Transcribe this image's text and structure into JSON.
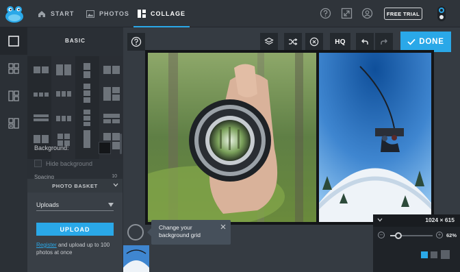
{
  "nav": {
    "tabs": [
      {
        "label": "START",
        "icon": "home-icon"
      },
      {
        "label": "PHOTOS",
        "icon": "image-icon"
      },
      {
        "label": "COLLAGE",
        "icon": "collage-icon",
        "active": true
      }
    ],
    "free_trial_label": "FREE TRIAL",
    "icons": [
      "help-icon",
      "fullscreen-icon",
      "account-icon"
    ]
  },
  "rail": {
    "items": [
      "layout-single-icon",
      "layout-grid-icon",
      "layout-columns-icon",
      "layout-mixed-icon"
    ],
    "active_index": 0
  },
  "panel": {
    "title": "BASIC",
    "background_label": "Background:",
    "background_color": "#141619",
    "hide_background_label": "Hide background",
    "spacing_label": "Spacing",
    "spacing_value": "10"
  },
  "basket": {
    "title": "PHOTO BASKET",
    "source_selected": "Uploads",
    "upload_label": "UPLOAD",
    "register_link": "Register",
    "note_text": " and upload up to 100 photos at once"
  },
  "toolbar": {
    "hq_label": "HQ",
    "done_label": "DONE",
    "icons": [
      "help-icon",
      "layers-icon",
      "shuffle-icon",
      "clear-icon",
      "undo-icon",
      "redo-icon"
    ]
  },
  "hint": {
    "line1": "Change your",
    "line2": "background grid"
  },
  "size": {
    "dimensions": "1024 × 615",
    "zoom_label": "62%",
    "zoom_fraction": 0.62
  },
  "colors": {
    "accent": "#2aa8e8",
    "topbar": "#2f343a",
    "panel": "#2a2f35",
    "workspace": "#353b42"
  }
}
